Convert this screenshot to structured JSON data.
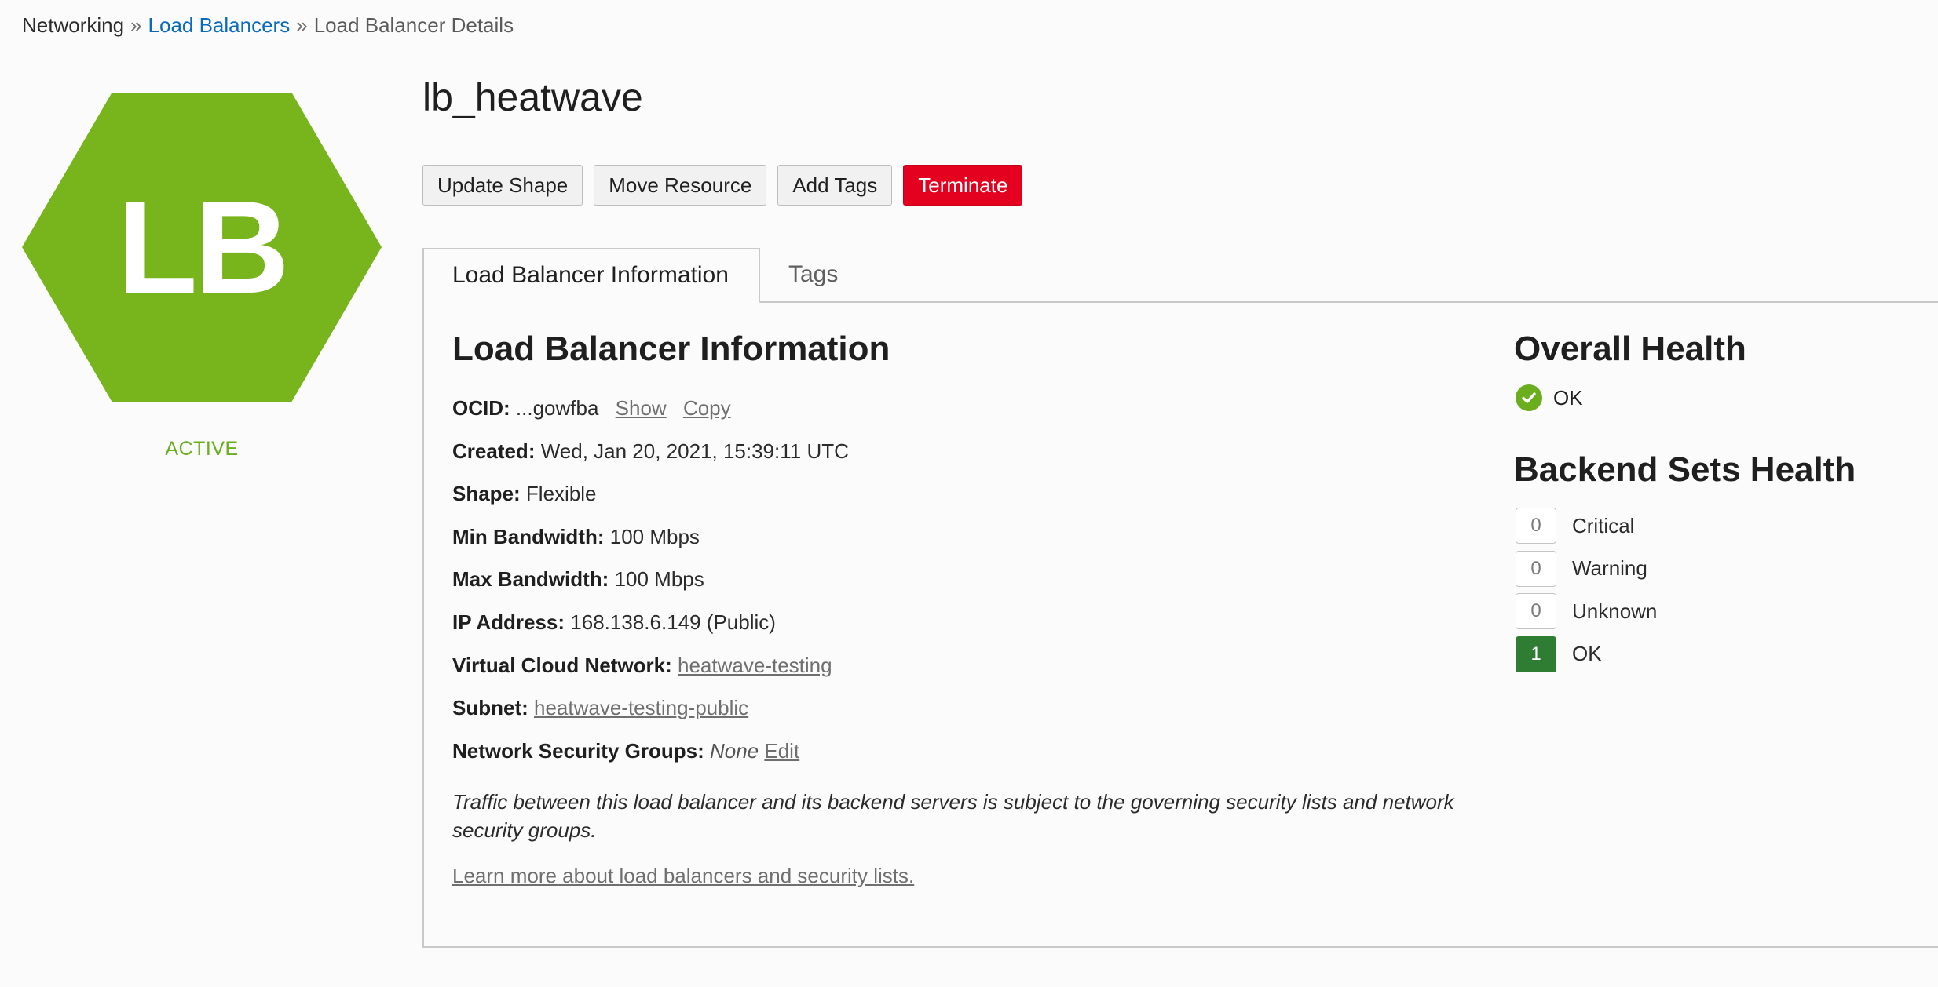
{
  "breadcrumb": {
    "root": "Networking",
    "sep": "»",
    "link": "Load Balancers",
    "current": "Load Balancer Details"
  },
  "resource": {
    "icon_text": "LB",
    "icon_color": "#78b41b",
    "lifecycle_state": "ACTIVE",
    "name": "lb_heatwave"
  },
  "actions": {
    "update_shape": "Update Shape",
    "move_resource": "Move Resource",
    "add_tags": "Add Tags",
    "terminate": "Terminate",
    "terminate_color": "#e4011f"
  },
  "tabs": {
    "info": "Load Balancer Information",
    "tags": "Tags"
  },
  "info": {
    "heading": "Load Balancer Information",
    "ocid_label": "OCID:",
    "ocid_value": "...gowfba",
    "ocid_show": "Show",
    "ocid_copy": "Copy",
    "created_label": "Created:",
    "created_value": "Wed, Jan 20, 2021, 15:39:11 UTC",
    "shape_label": "Shape:",
    "shape_value": "Flexible",
    "min_bw_label": "Min Bandwidth:",
    "min_bw_value": "100 Mbps",
    "max_bw_label": "Max Bandwidth:",
    "max_bw_value": "100 Mbps",
    "ip_label": "IP Address:",
    "ip_value": "168.138.6.149 (Public)",
    "vcn_label": "Virtual Cloud Network:",
    "vcn_value": "heatwave-testing",
    "subnet_label": "Subnet:",
    "subnet_value": "heatwave-testing-public",
    "nsg_label": "Network Security Groups:",
    "nsg_value": "None",
    "nsg_edit": "Edit",
    "note": "Traffic between this load balancer and its backend servers is subject to the governing security lists and network security groups.",
    "learn_more": "Learn more about load balancers and security lists."
  },
  "health": {
    "overall_heading": "Overall Health",
    "overall_status": "OK",
    "overall_icon": "check-circle-icon",
    "backend_heading": "Backend Sets Health",
    "backend": [
      {
        "count": "0",
        "label": "Critical"
      },
      {
        "count": "0",
        "label": "Warning"
      },
      {
        "count": "0",
        "label": "Unknown"
      },
      {
        "count": "1",
        "label": "OK"
      }
    ]
  }
}
